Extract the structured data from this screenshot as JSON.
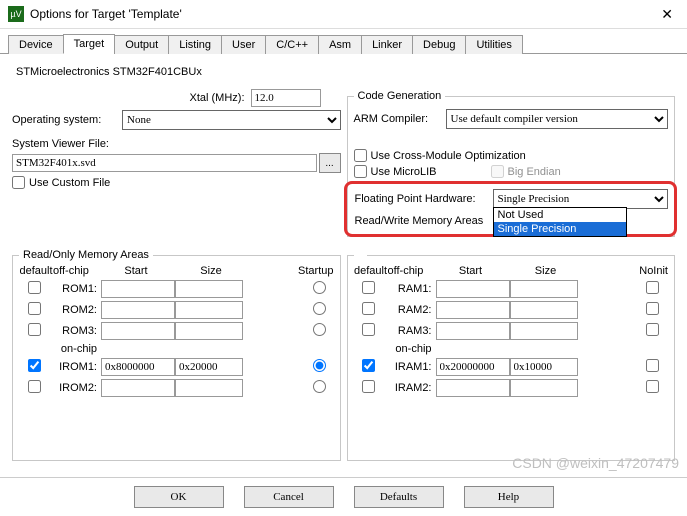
{
  "title": "Options for Target 'Template'",
  "tabs": [
    "Device",
    "Target",
    "Output",
    "Listing",
    "User",
    "C/C++",
    "Asm",
    "Linker",
    "Debug",
    "Utilities"
  ],
  "active_tab": 1,
  "chip": "STMicroelectronics STM32F401CBUx",
  "xtal_label": "Xtal (MHz):",
  "xtal_value": "12.0",
  "os_label": "Operating system:",
  "os_value": "None",
  "sv_label": "System Viewer File:",
  "sv_value": "STM32F401x.svd",
  "sv_browse": "...",
  "use_custom_label": "Use Custom File",
  "codegen": {
    "legend": "Code Generation",
    "arm_label": "ARM Compiler:",
    "arm_value": "Use default compiler version",
    "cross_label": "Use Cross-Module Optimization",
    "microlib_label": "Use MicroLIB",
    "bigendian_label": "Big Endian",
    "fph_label": "Floating Point Hardware:",
    "fph_value": "Single Precision",
    "fph_options": [
      "Not Used",
      "Single Precision"
    ]
  },
  "ro": {
    "legend": "Read/Only Memory Areas",
    "hdr": {
      "default": "default",
      "offchip": "off-chip",
      "onchip": "on-chip",
      "start": "Start",
      "size": "Size",
      "startup": "Startup"
    },
    "rows": [
      {
        "name": "ROM1:",
        "def": false,
        "start": "",
        "size": "",
        "startup": false
      },
      {
        "name": "ROM2:",
        "def": false,
        "start": "",
        "size": "",
        "startup": false
      },
      {
        "name": "ROM3:",
        "def": false,
        "start": "",
        "size": "",
        "startup": false
      },
      {
        "name": "IROM1:",
        "def": true,
        "start": "0x8000000",
        "size": "0x20000",
        "startup": true
      },
      {
        "name": "IROM2:",
        "def": false,
        "start": "",
        "size": "",
        "startup": false
      }
    ]
  },
  "rw": {
    "legend": "Read/Write Memory Areas",
    "hdr": {
      "default": "default",
      "offchip": "off-chip",
      "onchip": "on-chip",
      "start": "Start",
      "size": "Size",
      "noinit": "NoInit"
    },
    "rows": [
      {
        "name": "RAM1:",
        "def": false,
        "start": "",
        "size": "",
        "noinit": false
      },
      {
        "name": "RAM2:",
        "def": false,
        "start": "",
        "size": "",
        "noinit": false
      },
      {
        "name": "RAM3:",
        "def": false,
        "start": "",
        "size": "",
        "noinit": false
      },
      {
        "name": "IRAM1:",
        "def": true,
        "start": "0x20000000",
        "size": "0x10000",
        "noinit": false
      },
      {
        "name": "IRAM2:",
        "def": false,
        "start": "",
        "size": "",
        "noinit": false
      }
    ]
  },
  "buttons": {
    "ok": "OK",
    "cancel": "Cancel",
    "defaults": "Defaults",
    "help": "Help"
  },
  "watermark": "CSDN @weixin_47207479"
}
